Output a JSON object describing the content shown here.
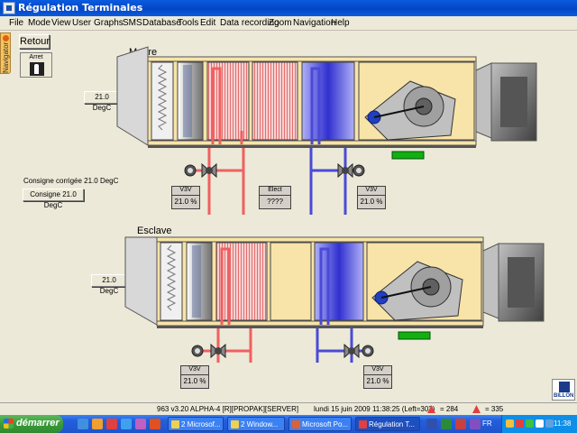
{
  "window": {
    "title": "Régulation Terminales"
  },
  "menu": [
    "File",
    "Mode",
    "View",
    "User",
    "Graphs",
    "SMS",
    "Database",
    "Tools",
    "Edit",
    "Data recording",
    "Zoom",
    "Navigation",
    "Help"
  ],
  "navigator": {
    "label": "Navigator"
  },
  "controls": {
    "retour_label": "Retour",
    "arret_label": "Arret",
    "consigne_corrigee": "Consigne corrigée 21.0 DegC",
    "consigne_button": "Consigne 21.0 DegC"
  },
  "master": {
    "title": "Maître",
    "temp_label": "21.0 DegC",
    "valve_left": {
      "name": "V3V",
      "value": "21.0 %"
    },
    "elect": {
      "name": "Elect",
      "value": "????"
    },
    "valve_right": {
      "name": "V3V",
      "value": "21.0 %"
    }
  },
  "slave": {
    "title": "Esclave",
    "temp_label": "21.0 DegC",
    "valve_left": {
      "name": "V3V",
      "value": "21.0 %"
    },
    "valve_right": {
      "name": "V3V",
      "value": "21.0 %"
    }
  },
  "status": {
    "version": "963 v3.20 ALPHA-4 [R][PROPAK][SERVER]",
    "datetime": "lundi 15 juin 2009 11:38:25 (Left=303)",
    "count_a": "= 284",
    "count_b": "= 335",
    "brand": "BILLON"
  },
  "taskbar": {
    "start_label": "démarrer",
    "tasks": [
      "2 Microsof...",
      "2 Window...",
      "Microsoft Po...",
      "Régulation T..."
    ],
    "lang": "FR",
    "clock": "11:38"
  },
  "colors": {
    "hot": "#f06060",
    "cold": "#4a4ad8",
    "casing": "#f8e4a8",
    "frame": "#555555",
    "green": "#10b010"
  }
}
